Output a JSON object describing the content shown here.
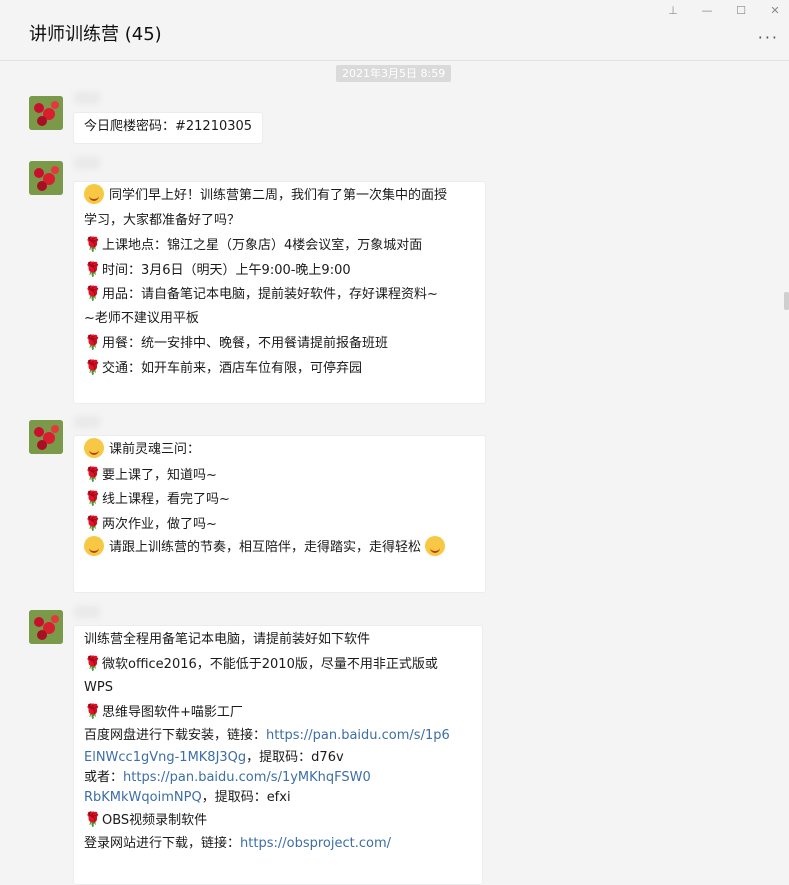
{
  "chat": {
    "title": "讲师训练营 (45)",
    "timestamp": "2021年3月5日 8:59"
  },
  "window_controls": {
    "pin": "⊥",
    "minimize": "—",
    "maximize": "☐",
    "close": "✕",
    "more": "···"
  },
  "messages": [
    {
      "lines": [
        "今日爬楼密码：#21210305"
      ]
    },
    {
      "lines": [
        "同学们早上好！训练营第二周，我们有了第一次集中的面授",
        "学习，大家都准备好了吗？",
        "上课地点：锦江之星（万象店）4楼会议室，万象城对面",
        "时间：3月6日（明天）上午9:00-晚上9:00",
        "用品：请自备笔记本电脑，提前装好软件，存好课程资料~",
        "~老师不建议用平板",
        "用餐：统一安排中、晚餐，不用餐请提前报备班班",
        "交通：如开车前来，酒店车位有限，可停弃园"
      ]
    },
    {
      "lines": [
        "课前灵魂三问：",
        "要上课了，知道吗~",
        "线上课程，看完了吗~",
        "两次作业，做了吗~",
        "请跟上训练营的节奏，相互陪伴，走得踏实，走得轻松"
      ]
    },
    {
      "lines": [
        "训练营全程用备笔记本电脑，请提前装好如下软件",
        "微软office2016，不能低于2010版，尽量不用非正式版或",
        "WPS",
        "思维导图软件+喵影工厂",
        "百度网盘进行下载安装，链接：",
        "https://pan.baidu.com/s/1p6",
        "ElNWcc1gVng-1MK8J3Qg",
        "，提取码：d76v",
        "或者：",
        "https://pan.baidu.com/s/1yMKhqFSW0",
        "RbKMkWqoimNPQ",
        "，提取码：efxi",
        "OBS视频录制软件",
        "登录网站进行下载，链接：",
        "https://obsproject.com/"
      ]
    }
  ]
}
